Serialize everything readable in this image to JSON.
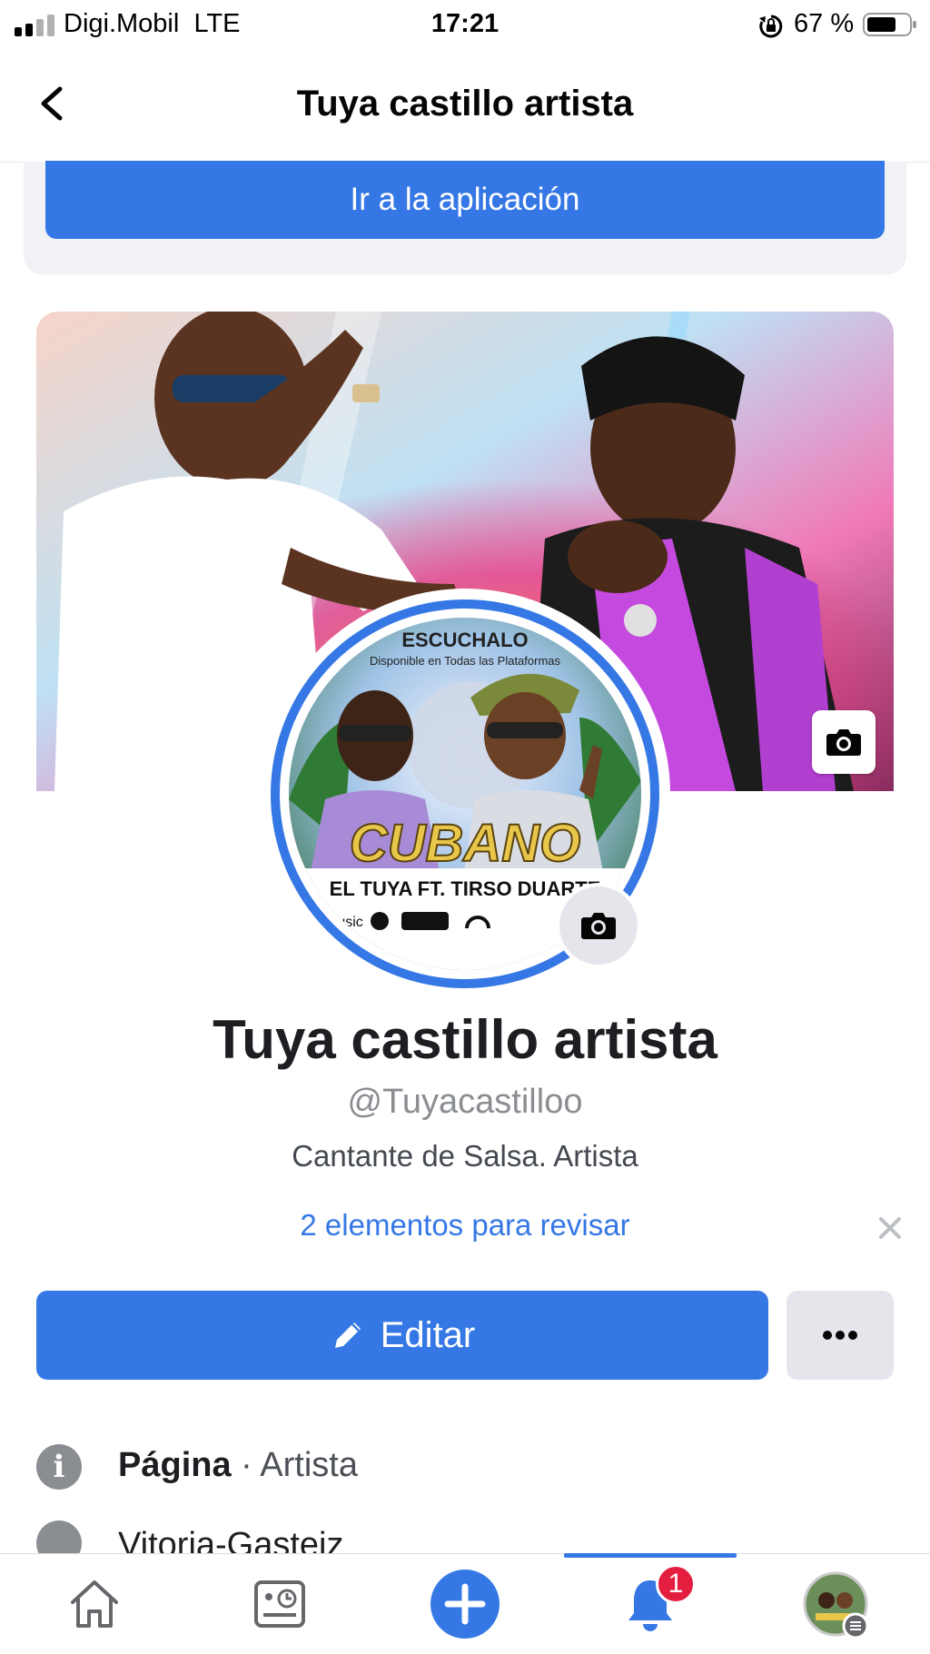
{
  "status_bar": {
    "carrier": "Digi.Mobil",
    "network": "LTE",
    "time": "17:21",
    "battery_percent": "67 %"
  },
  "header": {
    "title": "Tuya castillo artista",
    "back_icon": "chevron-left-icon"
  },
  "app_prompt": {
    "button_label": "Ir a la aplicación"
  },
  "profile": {
    "name": "Tuya castillo artista",
    "handle": "@Tuyacastilloo",
    "category": "Cantante de Salsa. Artista",
    "review_link": "2 elementos para revisar"
  },
  "profile_picture_text": {
    "top": "ESCUCHALO",
    "subtitle": "Disponible en Todas las Plataformas",
    "title": "CUBANO",
    "credits": "EL TUYA FT. TIRSO DUARTE",
    "platforms": [
      "music",
      "Spotify",
      "YouTube"
    ]
  },
  "actions": {
    "edit_label": "Editar",
    "more_icon": "ellipsis-icon"
  },
  "info": {
    "page_label": "Página",
    "separator": " · ",
    "page_category": "Artista",
    "location": "Vitoria-Gasteiz"
  },
  "bottom_nav": {
    "items": [
      "home-icon",
      "pages-feed-icon",
      "create-icon",
      "notifications-icon",
      "profile-menu-icon"
    ],
    "active": "notifications-icon",
    "notification_count": "1"
  },
  "colors": {
    "accent": "#3578e5",
    "badge": "#e41e3f",
    "secondary_bg": "#e4e6eb"
  }
}
